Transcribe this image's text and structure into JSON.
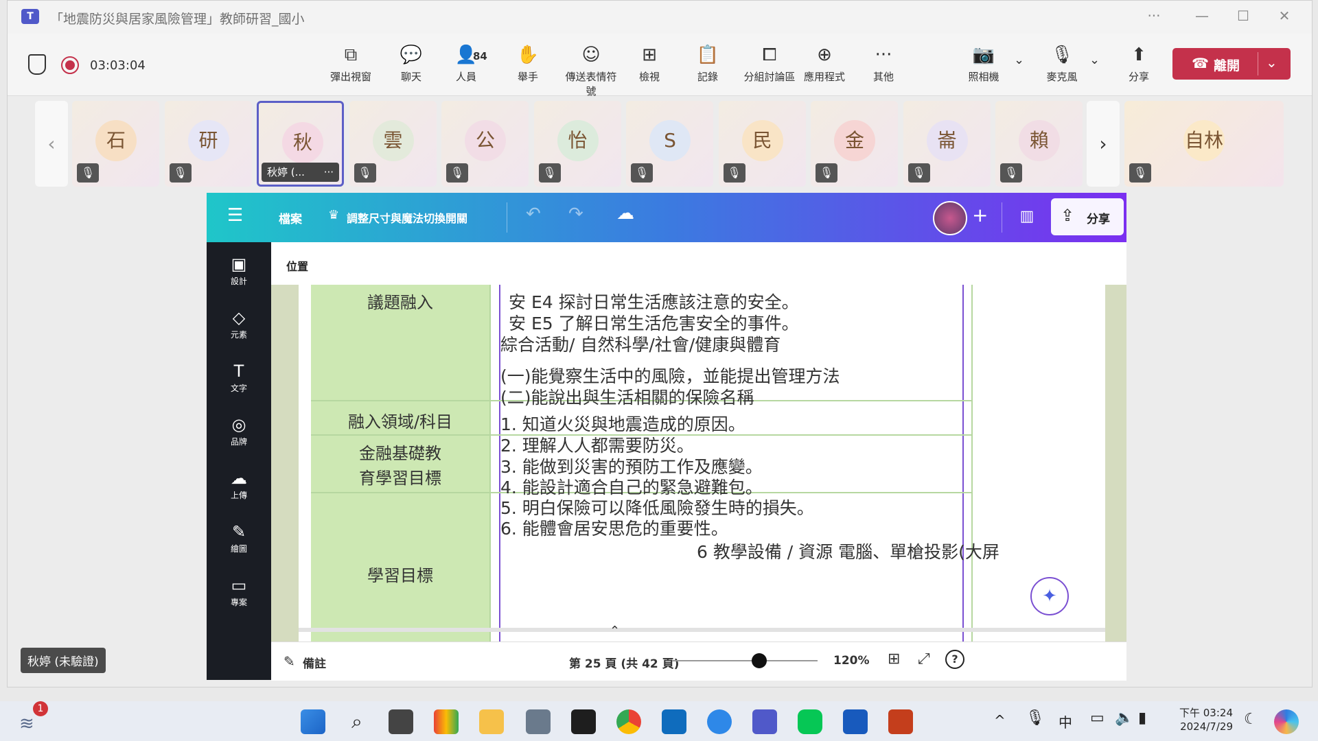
{
  "window": {
    "title": "「地震防災與居家風險管理」教師研習_國小",
    "more": "···",
    "minimize": "—",
    "maximize": "☐",
    "close": "✕"
  },
  "toolbar": {
    "timer": "03:03:04",
    "buttons": [
      {
        "label": "彈出視窗",
        "icon": "popout-icon",
        "glyph": "⧉"
      },
      {
        "label": "聊天",
        "icon": "chat-icon",
        "glyph": "💬"
      },
      {
        "label": "人員",
        "icon": "people-icon",
        "glyph": "👤"
      },
      {
        "label": "舉手",
        "icon": "raise-hand-icon",
        "glyph": "✋"
      },
      {
        "label": "傳送表情符號",
        "icon": "emoji-icon",
        "glyph": "☺"
      },
      {
        "label": "檢視",
        "icon": "view-icon",
        "glyph": "⊞"
      },
      {
        "label": "記錄",
        "icon": "notes-icon",
        "glyph": "📋"
      },
      {
        "label": "分組討論區",
        "icon": "breakout-icon",
        "glyph": "⧠"
      },
      {
        "label": "應用程式",
        "icon": "apps-icon",
        "glyph": "⊕"
      },
      {
        "label": "其他",
        "icon": "more-icon",
        "glyph": "···"
      },
      {
        "label": "照相機",
        "icon": "camera-off-icon",
        "glyph": "📷"
      },
      {
        "label": "麥克風",
        "icon": "mic-off-icon",
        "glyph": "🎙"
      },
      {
        "label": "分享",
        "icon": "share-icon",
        "glyph": "⬆"
      }
    ],
    "people_count": "84",
    "leave_label": "離開"
  },
  "participants": {
    "tiles": [
      {
        "initial": "石",
        "color": "#f7dfc4"
      },
      {
        "initial": "研",
        "color": "#e6e6f6"
      },
      {
        "initial": "秋",
        "color": "#f4d9e4"
      },
      {
        "initial": "雲",
        "color": "#e3eadb"
      },
      {
        "initial": "公",
        "color": "#f2dde6"
      },
      {
        "initial": "怡",
        "color": "#dcebdc"
      },
      {
        "initial": "S",
        "color": "#dfe7f5"
      },
      {
        "initial": "民",
        "color": "#f9e4c6"
      },
      {
        "initial": "金",
        "color": "#f6d5d4"
      },
      {
        "initial": "崙",
        "color": "#e8e2f3"
      },
      {
        "initial": "賴",
        "color": "#f1dde5"
      }
    ],
    "active_name": "秋婷 (...",
    "active_more": "···",
    "featured_initial": "自林",
    "prev_arrow": "‹",
    "next_arrow": "›",
    "mute_glyph": "🎙"
  },
  "canva": {
    "menu_icon": "☰",
    "file_label": "檔案",
    "magic_label": "調整尺寸與魔法切換開關",
    "plus": "+",
    "share_label": "分享",
    "position_label": "位置",
    "sidebar": [
      {
        "label": "設計",
        "glyph": "▣"
      },
      {
        "label": "元素",
        "glyph": "◇"
      },
      {
        "label": "文字",
        "glyph": "T"
      },
      {
        "label": "品牌",
        "glyph": "◎"
      },
      {
        "label": "上傳",
        "glyph": "☁"
      },
      {
        "label": "繪圖",
        "glyph": "✎"
      },
      {
        "label": "專案",
        "glyph": "▭"
      }
    ],
    "notes_label": "備註",
    "page_info": "第 25 頁 (共 42 頁)",
    "zoom": "120%",
    "zoom_level": 0.6
  },
  "document": {
    "left_cells": [
      "議題融入",
      "融入領域/科目",
      "金融基礎教",
      "育學習目標",
      "學習目標"
    ],
    "lines": [
      "安 E4 探討日常生活應該注意的安全。",
      "安 E5 了解日常生活危害安全的事件。",
      "綜合活動/ 自然科學/社會/健康與體育",
      "(一)能覺察生活中的風險，並能提出管理方法",
      "(二)能說出與生活相關的保險名稱",
      "1. 知道火災與地震造成的原因。",
      "2. 理解人人都需要防災。",
      "3. 能做到災害的預防工作及應變。",
      "4. 能設計適合自己的緊急避難包。",
      "5. 明白保險可以降低風險發生時的損失。",
      "6. 能體會居安思危的重要性。",
      "6 教學設備 / 資源 電腦、單槍投影(大屏"
    ]
  },
  "overlay": {
    "unverified_badge": "秋婷 (未驗證)"
  },
  "taskbar": {
    "notification_count": "1",
    "time": "下午 03:24",
    "date": "2024/7/29",
    "ime": "中",
    "chevron": "^"
  }
}
